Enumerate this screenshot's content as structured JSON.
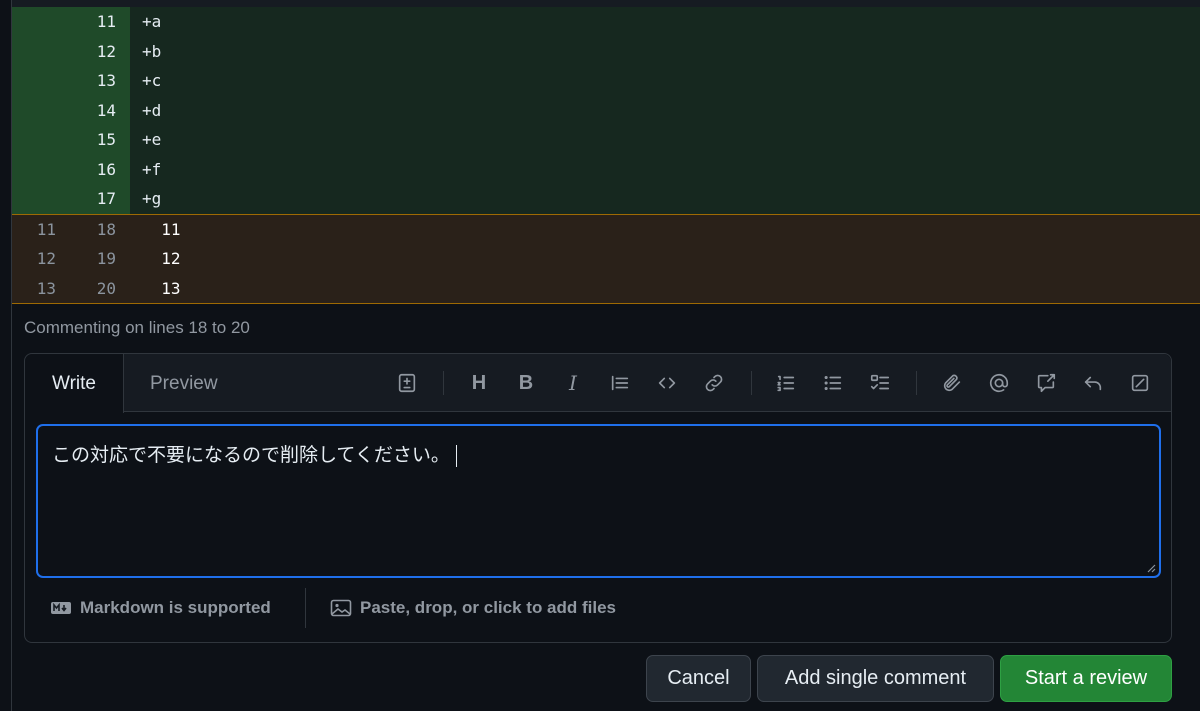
{
  "diff": {
    "added": [
      {
        "new": "11",
        "sign": "+",
        "text": "a"
      },
      {
        "new": "12",
        "sign": "+",
        "text": "b"
      },
      {
        "new": "13",
        "sign": "+",
        "text": "c"
      },
      {
        "new": "14",
        "sign": "+",
        "text": "d"
      },
      {
        "new": "15",
        "sign": "+",
        "text": "e"
      },
      {
        "new": "16",
        "sign": "+",
        "text": "f"
      },
      {
        "new": "17",
        "sign": "+",
        "text": "g"
      }
    ],
    "context": [
      {
        "old": "11",
        "new": "18",
        "text": "11"
      },
      {
        "old": "12",
        "new": "19",
        "text": "12"
      },
      {
        "old": "13",
        "new": "20",
        "text": "13"
      }
    ]
  },
  "commenting_label": "Commenting on lines 18 to 20",
  "editor": {
    "tabs": {
      "write": "Write",
      "preview": "Preview"
    },
    "toolbar": {
      "heading": "H",
      "bold": "B",
      "italic": "I"
    },
    "icons": [
      "diff-icon",
      "heading-icon",
      "bold-icon",
      "italic-icon",
      "quote-icon",
      "code-icon",
      "link-icon",
      "ordered-list-icon",
      "unordered-list-icon",
      "task-list-icon",
      "attach-icon",
      "mention-icon",
      "cross-reference-icon",
      "reply-icon",
      "fullscreen-icon"
    ],
    "text": "この対応で不要になるので削除してください。",
    "footer": {
      "markdown": "Markdown is supported",
      "files": "Paste, drop, or click to add files"
    }
  },
  "actions": {
    "cancel": "Cancel",
    "single": "Add single comment",
    "review": "Start a review"
  },
  "colors": {
    "accent": "#1f6feb",
    "primary_button": "#238636",
    "added_bg": "#16281f",
    "selection_border": "#9e6a03"
  }
}
